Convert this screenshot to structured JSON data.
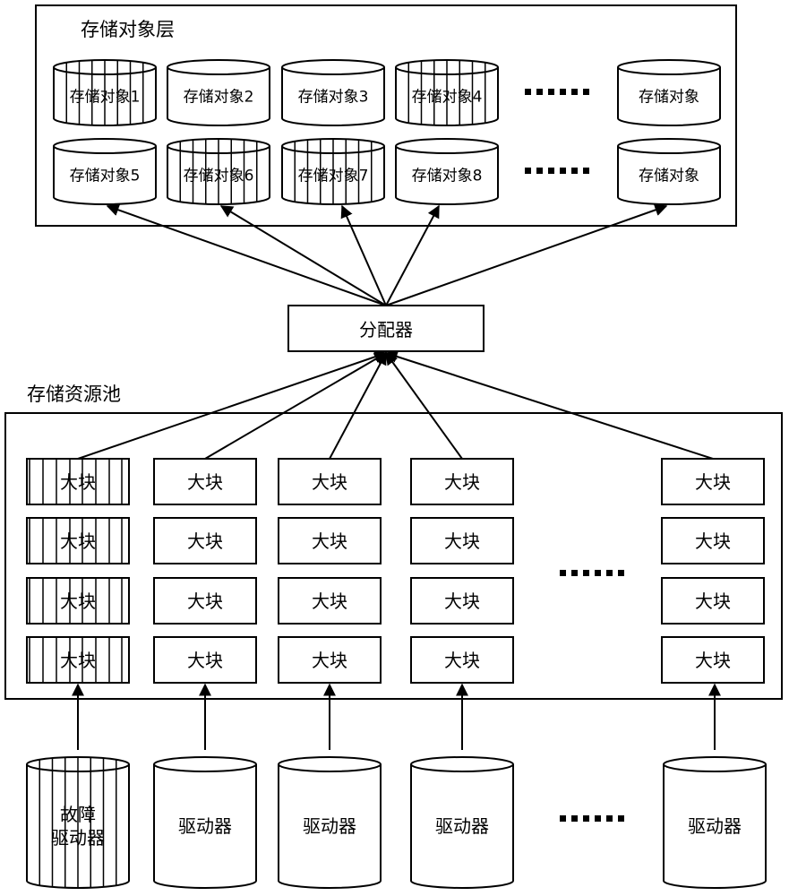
{
  "storage_object_layer": {
    "title": "存储对象层",
    "rows": [
      [
        {
          "label": "存储对象1",
          "hatched": true
        },
        {
          "label": "存储对象2",
          "hatched": false
        },
        {
          "label": "存储对象3",
          "hatched": false
        },
        {
          "label": "存储对象4",
          "hatched": true
        },
        {
          "label": "存储对象",
          "hatched": false
        }
      ],
      [
        {
          "label": "存储对象5",
          "hatched": false
        },
        {
          "label": "存储对象6",
          "hatched": true
        },
        {
          "label": "存储对象7",
          "hatched": true
        },
        {
          "label": "存储对象8",
          "hatched": false
        },
        {
          "label": "存储对象",
          "hatched": false
        }
      ]
    ],
    "ellipsis": "……"
  },
  "allocator": {
    "label": "分配器"
  },
  "storage_pool": {
    "title": "存储资源池",
    "block_label": "大块",
    "columns": [
      {
        "hatched": true,
        "blocks": 4
      },
      {
        "hatched": false,
        "blocks": 4
      },
      {
        "hatched": false,
        "blocks": 4
      },
      {
        "hatched": false,
        "blocks": 4
      },
      {
        "hatched": false,
        "blocks": 4
      }
    ]
  },
  "drives": [
    {
      "lines": [
        "故障",
        "驱动器"
      ],
      "hatched": true
    },
    {
      "lines": [
        "驱动器"
      ],
      "hatched": false
    },
    {
      "lines": [
        "驱动器"
      ],
      "hatched": false
    },
    {
      "lines": [
        "驱动器"
      ],
      "hatched": false
    },
    {
      "lines": [
        "驱动器"
      ],
      "hatched": false
    }
  ],
  "colors": {
    "stroke": "#000000",
    "background": "#ffffff"
  }
}
